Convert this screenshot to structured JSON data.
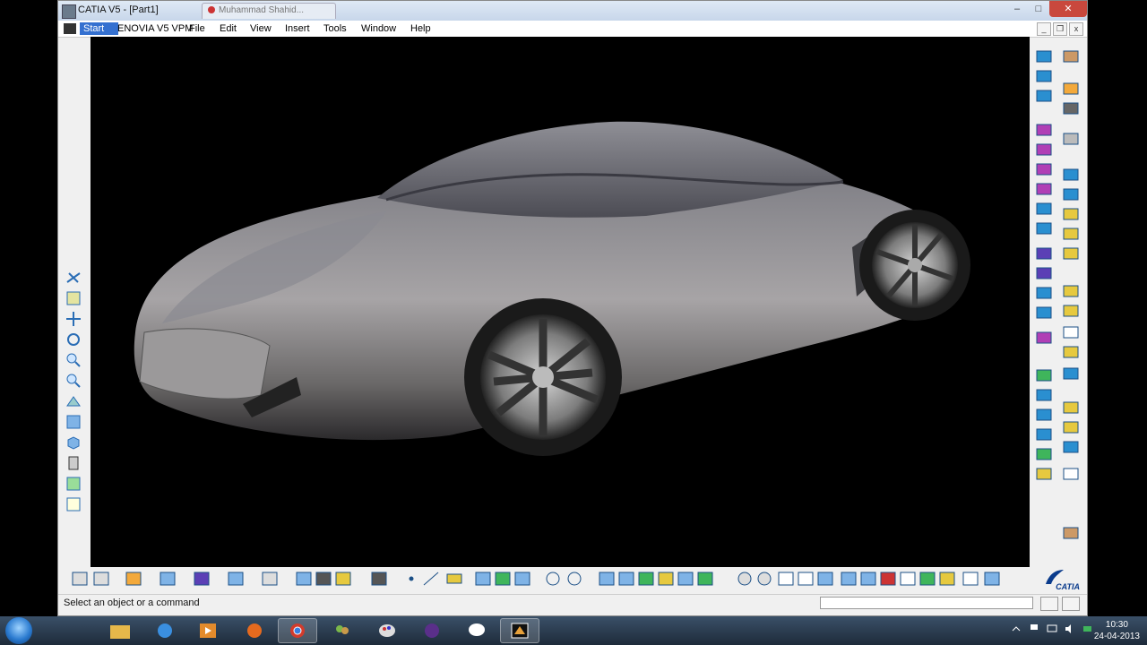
{
  "window": {
    "title": "CATIA V5 - [Part1]",
    "background_tab": "Muhammad Shahid...",
    "controls": {
      "minimize": "–",
      "maximize": "□",
      "close": "✕"
    }
  },
  "menubar": {
    "items": [
      "Start",
      "ENOVIA V5 VPM",
      "File",
      "Edit",
      "View",
      "Insert",
      "Tools",
      "Window",
      "Help"
    ]
  },
  "mdi_controls": {
    "minimize": "_",
    "restore": "❐",
    "close": "x"
  },
  "viewport": {
    "background": "#000000",
    "model": "sports-car"
  },
  "branding": {
    "logo_text": "CATIA"
  },
  "statusbar": {
    "message": "Select an object or a command",
    "command_value": ""
  },
  "taskbar": {
    "apps": [
      "windows-explorer-icon",
      "internet-explorer-icon",
      "media-player-icon",
      "firefox-icon",
      "chrome-icon",
      "contacts-icon",
      "paint-icon",
      "torrent-icon",
      "gtalk-icon",
      "catia-icon"
    ],
    "active_app": "chrome-icon",
    "clock": {
      "time": "10:30",
      "date": "24-04-2013"
    }
  },
  "colors": {
    "titlebar": "#c7d6ea",
    "close_button": "#c9483d",
    "start_highlight": "#3470d0",
    "taskbar": "#1e2b3a",
    "catia_blue": "#0a3b8c"
  }
}
